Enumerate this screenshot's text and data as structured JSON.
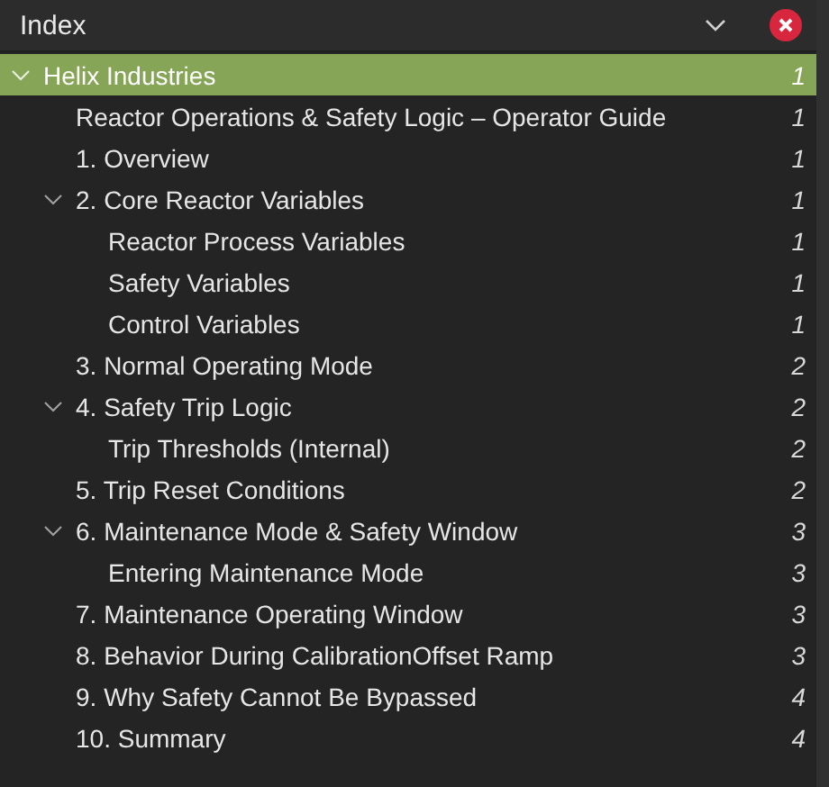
{
  "panel": {
    "title": "Index"
  },
  "tree": [
    {
      "label": "Helix Industries",
      "page": "1",
      "selected": true,
      "expanded": true,
      "children": [
        {
          "label": "Reactor Operations & Safety Logic – Operator Guide",
          "page": "1",
          "selected": false
        },
        {
          "label": "1. Overview",
          "page": "1",
          "selected": false
        },
        {
          "label": "2. Core Reactor Variables",
          "page": "1",
          "selected": false,
          "expanded": true,
          "children": [
            {
              "label": "Reactor Process Variables",
              "page": "1",
              "selected": false
            },
            {
              "label": "Safety Variables",
              "page": "1",
              "selected": false
            },
            {
              "label": "Control Variables",
              "page": "1",
              "selected": false
            }
          ]
        },
        {
          "label": "3. Normal Operating Mode",
          "page": "2",
          "selected": false
        },
        {
          "label": "4. Safety Trip Logic",
          "page": "2",
          "selected": false,
          "expanded": true,
          "children": [
            {
              "label": "Trip Thresholds (Internal)",
              "page": "2",
              "selected": false
            }
          ]
        },
        {
          "label": "5. Trip Reset Conditions",
          "page": "2",
          "selected": false
        },
        {
          "label": "6. Maintenance Mode & Safety Window",
          "page": "3",
          "selected": false,
          "expanded": true,
          "children": [
            {
              "label": "Entering Maintenance Mode",
              "page": "3",
              "selected": false
            }
          ]
        },
        {
          "label": "7. Maintenance Operating Window",
          "page": "3",
          "selected": false
        },
        {
          "label": "8. Behavior During CalibrationOffset Ramp",
          "page": "3",
          "selected": false
        },
        {
          "label": "9. Why Safety Cannot Be Bypassed",
          "page": "4",
          "selected": false
        },
        {
          "label": "10. Summary",
          "page": "4",
          "selected": false
        }
      ]
    }
  ]
}
